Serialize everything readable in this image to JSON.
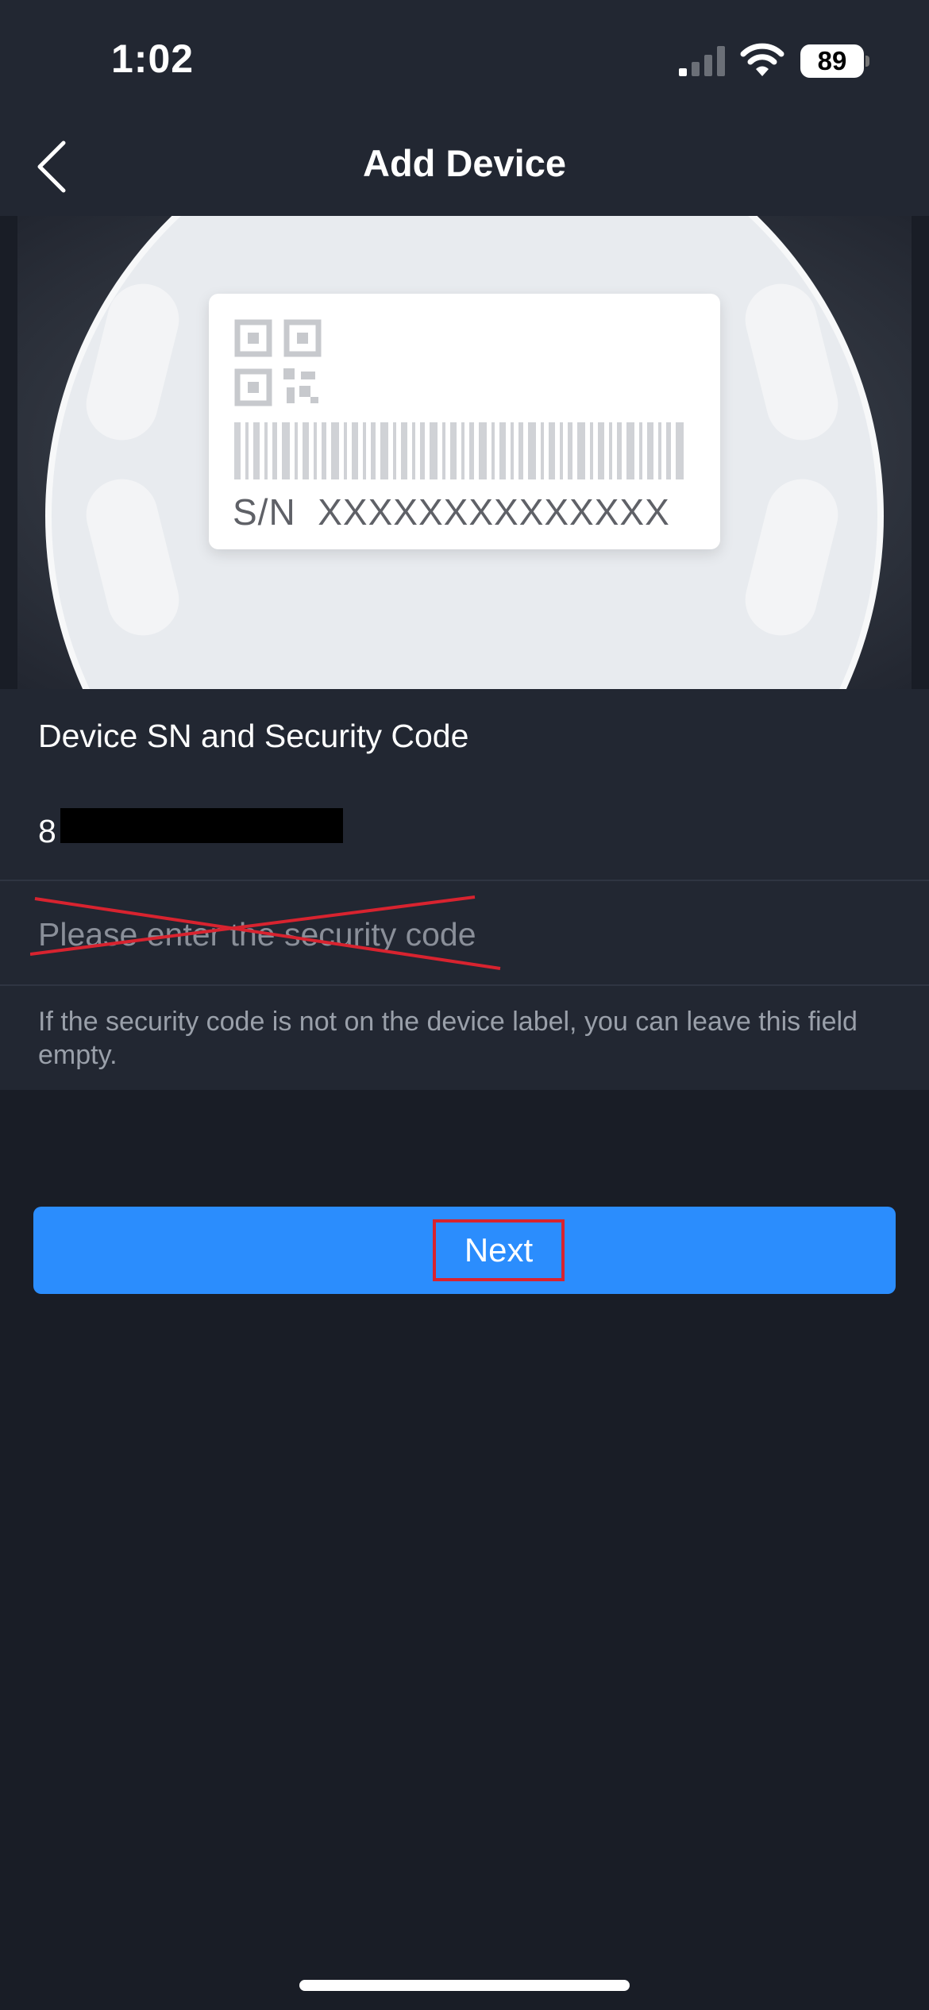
{
  "status_bar": {
    "time": "1:02",
    "battery": "89"
  },
  "nav": {
    "title": "Add Device"
  },
  "device_label": {
    "sn_text": "S/N  XXXXXXXXXXXXXX"
  },
  "form": {
    "section_title": "Device SN and Security Code",
    "sn_value": "8",
    "security_code": {
      "value": "",
      "placeholder": "Please enter the security code"
    },
    "hint": "If the security code is not on the device label, you can leave this field empty."
  },
  "actions": {
    "next_label": "Next"
  },
  "colors": {
    "primary": "#2b8dfd",
    "background": "#191d26",
    "panel": "#222732",
    "annotation": "#d8232f"
  }
}
